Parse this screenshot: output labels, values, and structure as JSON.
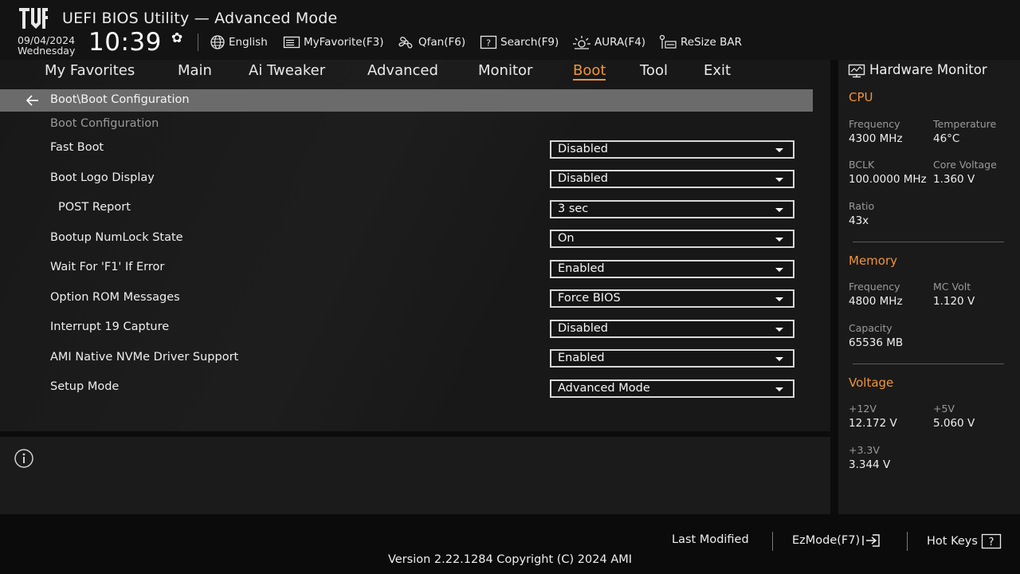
{
  "header": {
    "title": "UEFI BIOS Utility — Advanced Mode",
    "date": "09/04/2024",
    "weekday": "Wednesday",
    "time": "10:39",
    "tools": {
      "language": "English",
      "favorite": "MyFavorite(F3)",
      "qfan": "Qfan(F6)",
      "search": "Search(F9)",
      "aura": "AURA(F4)",
      "resize_bar": "ReSize BAR"
    }
  },
  "tabs": [
    "My Favorites",
    "Main",
    "Ai Tweaker",
    "Advanced",
    "Monitor",
    "Boot",
    "Tool",
    "Exit"
  ],
  "active_tab": "Boot",
  "breadcrumb": "Boot\\Boot Configuration",
  "section_title": "Boot Configuration",
  "settings": [
    {
      "label": "Fast Boot",
      "value": "Disabled"
    },
    {
      "label": "Boot Logo Display",
      "value": "Disabled"
    },
    {
      "label": "POST Report",
      "value": "3 sec"
    },
    {
      "label": "Bootup NumLock State",
      "value": "On"
    },
    {
      "label": "Wait For 'F1' If Error",
      "value": "Enabled"
    },
    {
      "label": "Option ROM Messages",
      "value": "Force BIOS"
    },
    {
      "label": "Interrupt 19 Capture",
      "value": "Disabled"
    },
    {
      "label": "AMI Native NVMe Driver Support",
      "value": "Enabled"
    },
    {
      "label": "Setup Mode",
      "value": "Advanced Mode"
    }
  ],
  "hardware_monitor": {
    "title": "Hardware Monitor",
    "cpu": {
      "heading": "CPU",
      "frequency_label": "Frequency",
      "frequency": "4300 MHz",
      "temperature_label": "Temperature",
      "temperature": "46°C",
      "bclk_label": "BCLK",
      "bclk": "100.0000 MHz",
      "core_voltage_label": "Core Voltage",
      "core_voltage": "1.360 V",
      "ratio_label": "Ratio",
      "ratio": "43x"
    },
    "memory": {
      "heading": "Memory",
      "frequency_label": "Frequency",
      "frequency": "4800 MHz",
      "mc_volt_label": "MC Volt",
      "mc_volt": "1.120 V",
      "capacity_label": "Capacity",
      "capacity": "65536 MB"
    },
    "voltage": {
      "heading": "Voltage",
      "v12_label": "+12V",
      "v12": "12.172 V",
      "v5_label": "+5V",
      "v5": "5.060 V",
      "v33_label": "+3.3V",
      "v33": "3.344 V"
    }
  },
  "footer": {
    "last_modified": "Last Modified",
    "ezmode": "EzMode(F7)",
    "hot_keys": "Hot Keys",
    "version": "Version 2.22.1284 Copyright (C) 2024 AMI"
  },
  "colors": {
    "accent": "#f0953a",
    "background": "#181818",
    "breadcrumb": "#6b6b6b"
  },
  "icons": [
    "tuf-logo",
    "gear-icon",
    "globe-icon",
    "favorite-icon",
    "fan-icon",
    "search-icon",
    "aura-icon",
    "resize-bar-icon",
    "back-arrow-icon",
    "info-icon",
    "monitor-icon",
    "exit-arrow-icon",
    "question-icon"
  ]
}
